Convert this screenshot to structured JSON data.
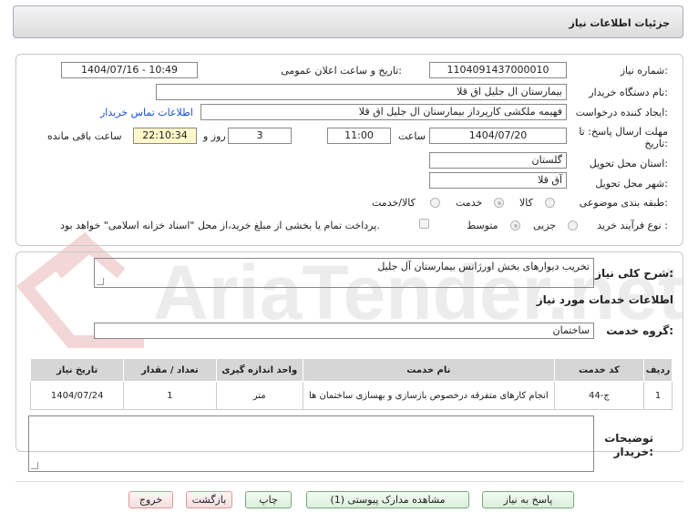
{
  "header": {
    "title": "جزئیات اطلاعات نیاز"
  },
  "form": {
    "need_number_label": "شماره نیاز:",
    "need_number": "1104091437000010",
    "announce_label": "تاریخ و ساعت اعلان عمومی:",
    "announce_value": "1404/07/16 - 10:49",
    "buyer_org_label": "نام دستگاه خریدار:",
    "buyer_org": "بیمارستان ال جلیل اق قلا",
    "creator_label": "ایجاد کننده درخواست:",
    "creator": "فهیمه ملکشی کارپرداز بیمارستان ال جلیل اق قلا",
    "contact_link": "اطلاعات تماس خریدار",
    "deadline_label_1": "مهلت ارسال پاسخ: تا",
    "deadline_label_2": "تاریخ:",
    "deadline_date": "1404/07/20",
    "time_label": "ساعت",
    "deadline_time": "11:00",
    "days_value": "3",
    "days_label": "روز و",
    "remaining_time": "22:10:34",
    "remaining_label": "ساعت باقی مانده",
    "province_label": "استان محل تحویل:",
    "province": "گلستان",
    "city_label": "شهر محل تحویل:",
    "city": "آق قلا",
    "category_label": "طبقه بندی موضوعی:",
    "category_options": [
      "کالا",
      "خدمت",
      "کالا/خدمت"
    ],
    "category_selected": "خدمت",
    "process_label": "نوع فرآیند خرید :",
    "process_options": [
      "جزیی",
      "متوسط"
    ],
    "process_selected": "متوسط",
    "payment_note": "پرداخت تمام یا بخشی از مبلغ خرید،از محل \"اسناد خزانه اسلامی\" خواهد بود."
  },
  "details": {
    "summary_label": "شرح کلی نیاز:",
    "summary": "تخریب دیوارهای بخش اورژانس بیمارستان آل جلیل",
    "services_title": "اطلاعات خدمات مورد نیاز",
    "service_group_label": "گروه خدمت:",
    "service_group": "ساختمان"
  },
  "table": {
    "headers": [
      "ردیف",
      "کد خدمت",
      "نام خدمت",
      "واحد اندازه گیری",
      "تعداد / مقدار",
      "تاریخ نیاز"
    ],
    "rows": [
      [
        "1",
        "ج-44",
        "انجام کارهای متفرقه درخصوص بازسازی و بهسازی ساختمان ها",
        "متر",
        "1",
        "1404/07/24"
      ]
    ]
  },
  "notes": {
    "label_1": "توضیحات",
    "label_2": "خریدار:",
    "value": ""
  },
  "buttons": {
    "reply": "پاسخ به نیاز",
    "attachments": "مشاهده مدارک پیوستی (1)",
    "print": "چاپ",
    "back": "بازگشت",
    "exit": "خروج"
  },
  "watermark": {
    "text": "AriaTender.net"
  },
  "colors": {
    "link": "#1a4fd6",
    "time_bg": "#fff8c8",
    "button_green": "#dcefdc",
    "button_red": "#f3dede"
  }
}
